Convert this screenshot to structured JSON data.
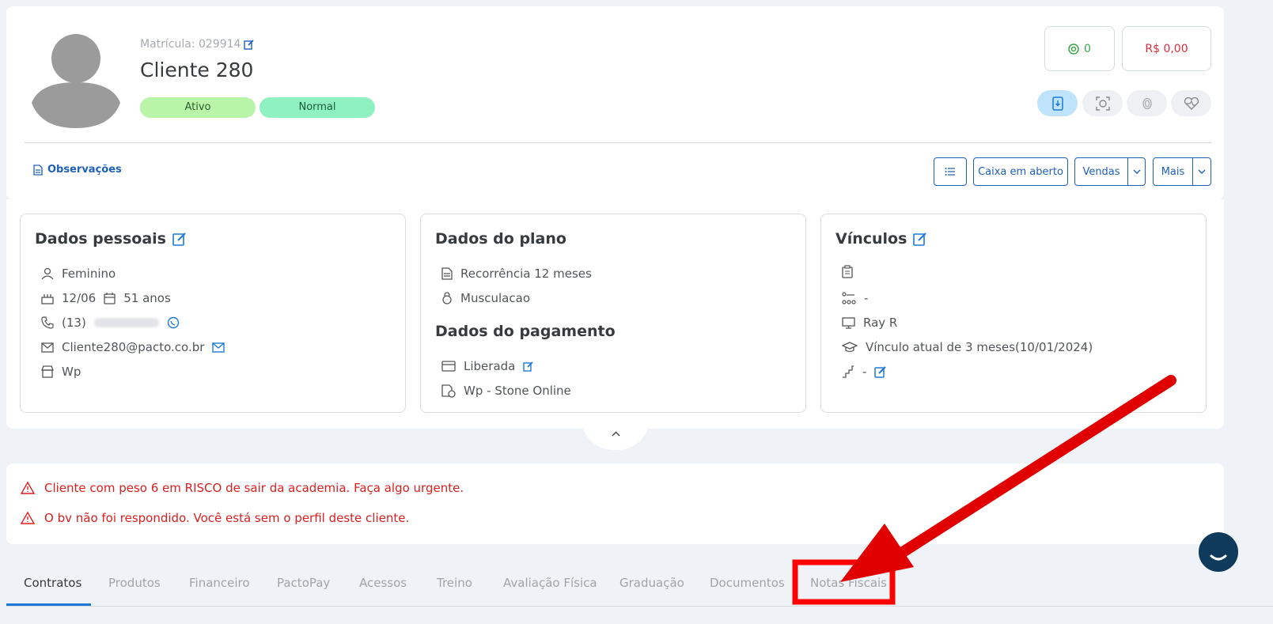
{
  "header": {
    "matricula": "Matrícula: 029914",
    "client_name": "Cliente 280",
    "badges": [
      "Ativo",
      "Normal"
    ],
    "points": "0",
    "balance": "R$ 0,00",
    "observacoes": "Observações",
    "buttons": {
      "caixa": "Caixa em aberto",
      "vendas": "Vendas",
      "mais": "Mais"
    }
  },
  "personal": {
    "title": "Dados pessoais",
    "gender": "Feminino",
    "birthday": "12/06",
    "age": "51 anos",
    "phone": "(13)",
    "email": "Cliente280@pacto.co.br",
    "unit": "Wp"
  },
  "plan": {
    "title": "Dados do plano",
    "plan_name": "Recorrência 12 meses",
    "modality": "Musculacao",
    "payment_title": "Dados do pagamento",
    "payment_status": "Liberada",
    "payment_method": "Wp - Stone Online"
  },
  "links": {
    "title": "Vínculos",
    "consultant": "-",
    "professor": "Ray R",
    "vinculo": "Vínculo atual de 3 meses(10/01/2024)",
    "level": "-"
  },
  "alerts": [
    "Cliente com peso 6 em RISCO de sair da academia. Faça algo urgente.",
    "O bv não foi respondido. Você está sem o perfil deste cliente."
  ],
  "tabs": [
    "Contratos",
    "Produtos",
    "Financeiro",
    "PactoPay",
    "Acessos",
    "Treino",
    "Avaliação Física",
    "Graduação",
    "Documentos",
    "Notas Fiscais"
  ],
  "colors": {
    "accent": "#1e60b8",
    "alert": "#db1f1f",
    "annotation": "#ff0000"
  }
}
